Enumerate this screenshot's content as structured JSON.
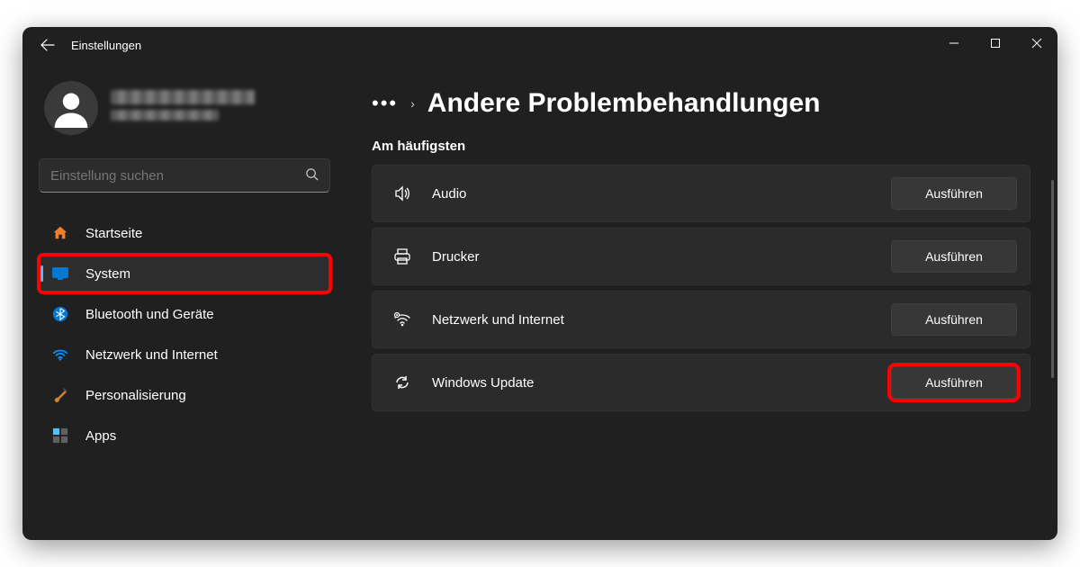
{
  "app_title": "Einstellungen",
  "search": {
    "placeholder": "Einstellung suchen"
  },
  "sidebar": {
    "items": [
      {
        "label": "Startseite"
      },
      {
        "label": "System"
      },
      {
        "label": "Bluetooth und Geräte"
      },
      {
        "label": "Netzwerk und Internet"
      },
      {
        "label": "Personalisierung"
      },
      {
        "label": "Apps"
      }
    ]
  },
  "breadcrumb": {
    "title": "Andere Problembehandlungen"
  },
  "section": {
    "label": "Am häufigsten"
  },
  "troubleshooters": [
    {
      "label": "Audio",
      "action": "Ausführen"
    },
    {
      "label": "Drucker",
      "action": "Ausführen"
    },
    {
      "label": "Netzwerk und Internet",
      "action": "Ausführen"
    },
    {
      "label": "Windows Update",
      "action": "Ausführen"
    }
  ]
}
